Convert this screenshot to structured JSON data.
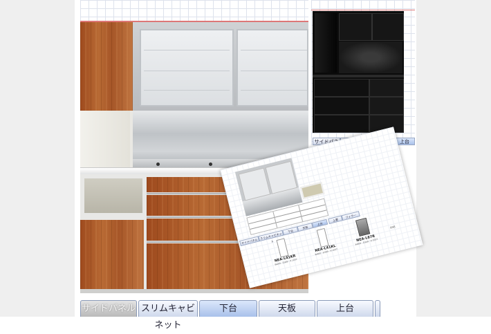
{
  "main_tabs": [
    {
      "label": "サイドパネル",
      "state": "disabled"
    },
    {
      "label": "スリムキャビネット",
      "state": "normal"
    },
    {
      "label": "下台",
      "state": "active"
    },
    {
      "label": "天板",
      "state": "normal"
    },
    {
      "label": "上台",
      "state": "normal"
    }
  ],
  "preview_tabs": [
    {
      "label": "サイドパネル"
    },
    {
      "label": "下台"
    },
    {
      "label": "天板"
    },
    {
      "label": "上台"
    }
  ],
  "card": {
    "tabs": [
      "サイドパネル",
      "スリムキャビネット",
      "下台",
      "天板",
      "上台"
    ],
    "subtabs": [
      "上置",
      "フィラー"
    ],
    "products": [
      {
        "code": "NEA-L41KR",
        "size": "W400 · D349 · H 1037"
      },
      {
        "code": "NEA-L41KL",
        "size": "W400 · D349 · H 1037"
      },
      {
        "code": "NEA-L67R",
        "size": "W400 · D349 · H 1037"
      }
    ],
    "side_label": "998"
  },
  "colors": {
    "wood": "#b0602e",
    "tab_active": "#a9c1ea",
    "tab": "#cfd9ec",
    "black_cabinet": "#0b0b0b"
  }
}
